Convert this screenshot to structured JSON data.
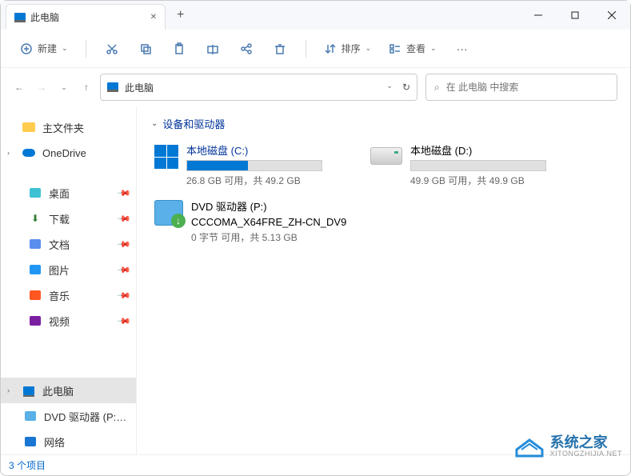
{
  "tab": {
    "title": "此电脑"
  },
  "toolbar": {
    "new": "新建",
    "sort": "排序",
    "view": "查看"
  },
  "address": {
    "location": "此电脑"
  },
  "search": {
    "placeholder": "在 此电脑 中搜索"
  },
  "sidebar": {
    "main_folder": "主文件夹",
    "onedrive": "OneDrive",
    "items": [
      {
        "label": "桌面"
      },
      {
        "label": "下载"
      },
      {
        "label": "文档"
      },
      {
        "label": "图片"
      },
      {
        "label": "音乐"
      },
      {
        "label": "视频"
      }
    ],
    "this_pc": "此电脑",
    "dvd": "DVD 驱动器 (P:) C",
    "network": "网络"
  },
  "group": {
    "title": "设备和驱动器"
  },
  "drives": [
    {
      "title": "本地磁盘 (C:)",
      "sub": "26.8 GB 可用，共 49.2 GB",
      "fill": 45,
      "kind": "os"
    },
    {
      "title": "本地磁盘 (D:)",
      "sub": "49.9 GB 可用，共 49.9 GB",
      "fill": 0,
      "kind": "hdd"
    },
    {
      "title": "DVD 驱动器 (P:)",
      "title2": "CCCOMA_X64FRE_ZH-CN_DV9",
      "sub": "0 字节 可用，共 5.13 GB",
      "kind": "dvd"
    }
  ],
  "status": {
    "count": "3 个项目"
  },
  "watermark": {
    "name": "系统之家",
    "url": "XITONGZHIJIA.NET"
  }
}
